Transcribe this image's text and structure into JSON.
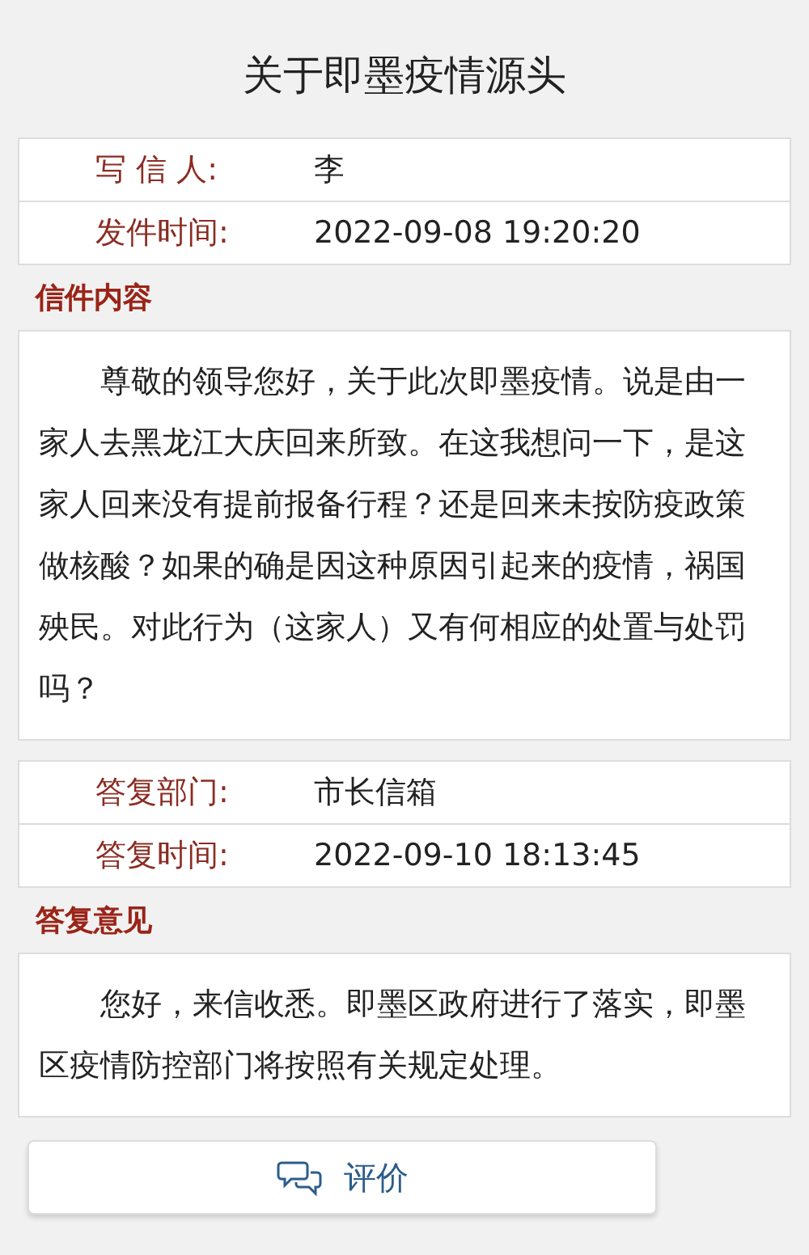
{
  "title": "关于即墨疫情源头",
  "letter_info": [
    {
      "label": "写 信 人:",
      "value": "李"
    },
    {
      "label": "发件时间:",
      "value": "2022-09-08 19:20:20"
    }
  ],
  "letter_heading": "信件内容",
  "letter_body": "尊敬的领导您好，关于此次即墨疫情。说是由一家人去黑龙江大庆回来所致。在这我想问一下，是这家人回来没有提前报备行程？还是回来未按防疫政策做核酸？如果的确是因这种原因引起来的疫情，祸国殃民。对此行为（这家人）又有何相应的处置与处罚吗？",
  "reply_info": [
    {
      "label": "答复部门:",
      "value": "市长信箱"
    },
    {
      "label": "答复时间:",
      "value": "2022-09-10 18:13:45"
    }
  ],
  "reply_heading": "答复意见",
  "reply_body": "您好，来信收悉。即墨区政府进行了落实，即墨区疫情防控部门将按照有关规定处理。",
  "rate_button": {
    "label": "评价"
  }
}
